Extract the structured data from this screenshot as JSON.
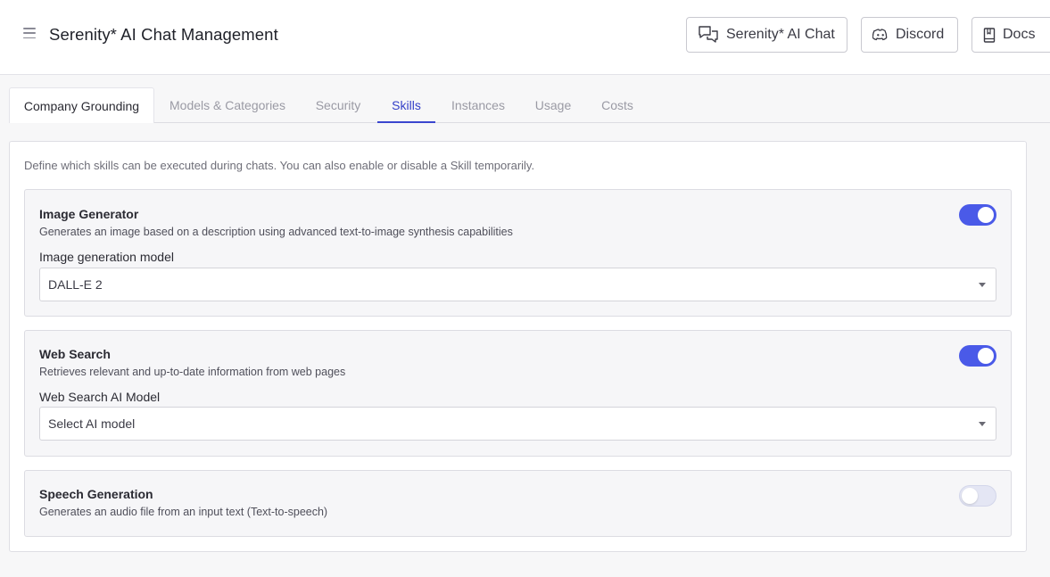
{
  "header": {
    "title": "Serenity* AI Chat Management",
    "buttons": {
      "chat": "Serenity* AI Chat",
      "discord": "Discord",
      "docs": "Docs"
    }
  },
  "tabs": [
    {
      "label": "Company Grounding"
    },
    {
      "label": "Models & Categories"
    },
    {
      "label": "Security"
    },
    {
      "label": "Skills"
    },
    {
      "label": "Instances"
    },
    {
      "label": "Usage"
    },
    {
      "label": "Costs"
    }
  ],
  "active_tab": "Skills",
  "skills_panel": {
    "intro": "Define which skills can be executed during chats. You can also enable or disable a Skill temporarily.",
    "skills": [
      {
        "title": "Image Generator",
        "description": "Generates an image based on a description using advanced text-to-image synthesis capabilities",
        "field_label": "Image generation model",
        "field_value": "DALL-E 2",
        "enabled": true
      },
      {
        "title": "Web Search",
        "description": "Retrieves relevant and up-to-date information from web pages",
        "field_label": "Web Search AI Model",
        "field_value": "Select AI model",
        "enabled": true
      },
      {
        "title": "Speech Generation",
        "description": "Generates an audio file from an input text (Text-to-speech)",
        "enabled": false
      }
    ]
  },
  "colors": {
    "accent": "#4a5ae8",
    "active_tab_text": "#3540c8",
    "toggle_off": "#e4e6f4"
  }
}
